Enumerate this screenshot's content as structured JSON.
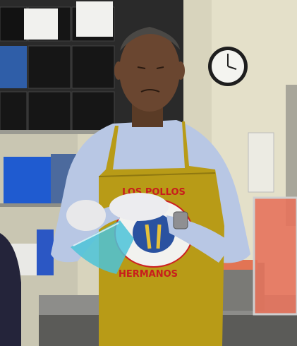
{
  "photo": {
    "apron_text_top": "LOS POLLOS",
    "apron_text_bottom": "HERMANOS",
    "sign_left": "",
    "sign_right": ""
  },
  "colors": {
    "wall": "#d8d4bd",
    "apron": "#b89b17",
    "shirt": "#b8c7e4",
    "crates": "#1a1a1a",
    "blue_bin": "#1f5bd0",
    "watermelon": "#e5735c",
    "counter": "#8d8d8a"
  }
}
